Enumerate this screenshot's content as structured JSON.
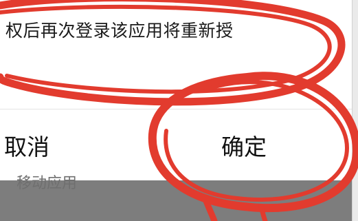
{
  "dialog": {
    "message": "权后再次登录该应用将重新授",
    "cancel_label": "取消",
    "confirm_label": "确定"
  },
  "background": {
    "label": "移动应用"
  },
  "annotation": {
    "color": "#e23b2e"
  }
}
